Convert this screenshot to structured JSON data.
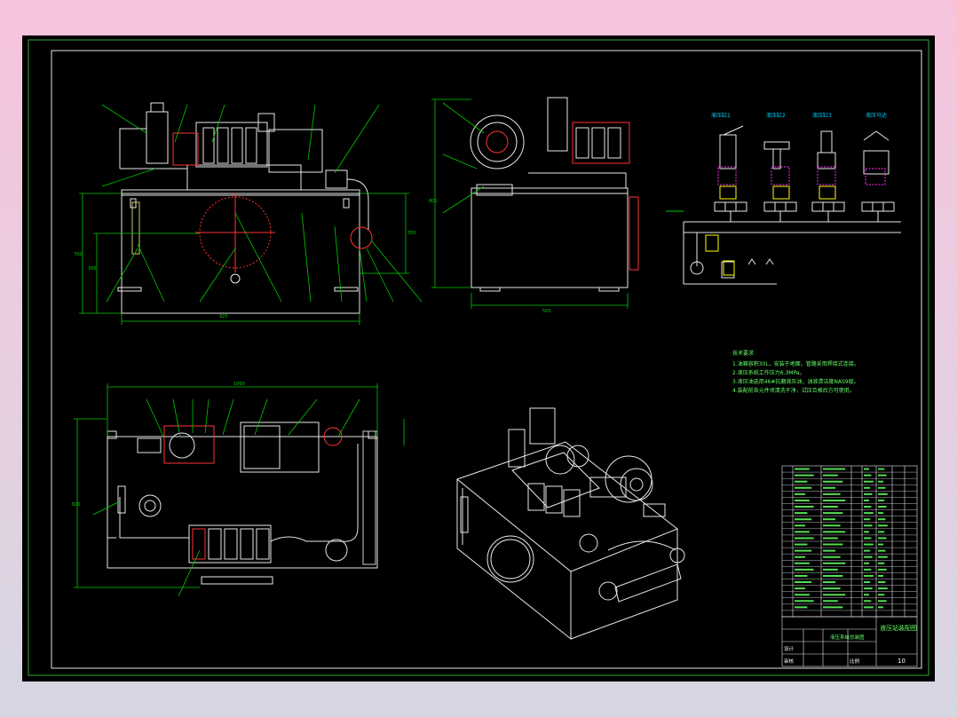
{
  "drawing": {
    "notes_title": "技术要求",
    "notes": [
      "1.油箱容积30L，安装于地面，管路采用焊接式连接。",
      "2.液压系统工作压力6.3MPa。",
      "3.液压油选用46#抗磨液压油，油液清洁度NAS9级。",
      "4.装配前各元件须清洗干净，试压合格后方可使用。"
    ],
    "title_block": {
      "drawing_name": "液压系统总装图",
      "product_name": "液压站装配图",
      "designer": "设计",
      "checker": "审核",
      "scale": "比例",
      "sheet": "10"
    },
    "symbols": {
      "actuator_labels": [
        "液压缸1",
        "液压缸2",
        "液压缸3",
        "液压马达"
      ]
    },
    "colors": {
      "background": "#000000",
      "line": "#ffffff",
      "dimension": "#00ff00",
      "leader": "#00ff00",
      "accent": "#ff3333",
      "symbol": "#ffff00",
      "magenta": "#ff33ff",
      "frame": "#00ff00"
    }
  }
}
